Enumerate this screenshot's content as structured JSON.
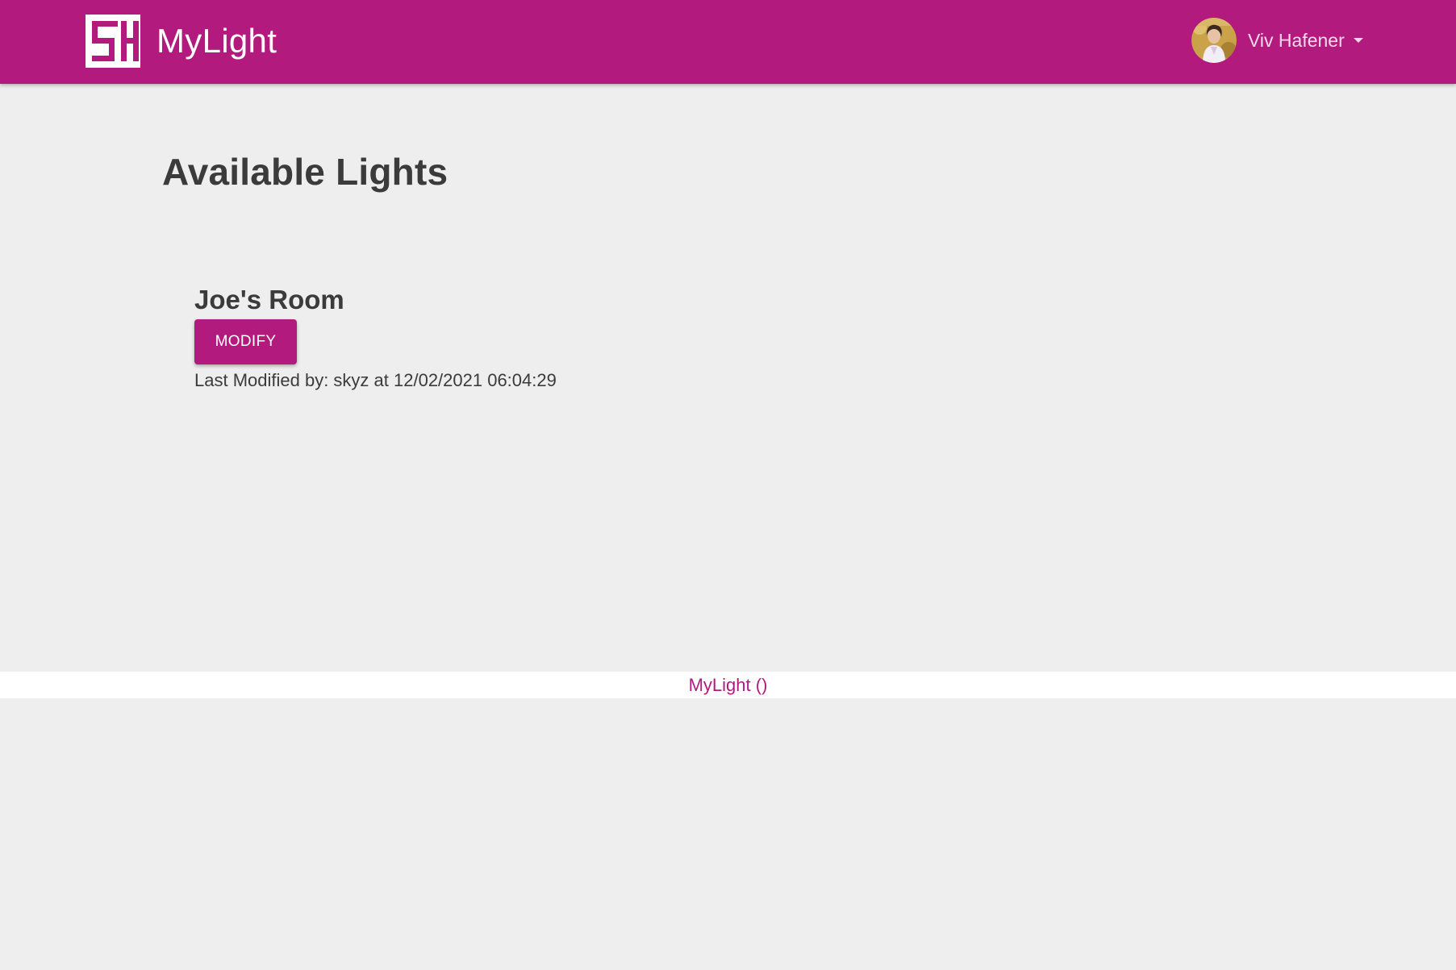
{
  "header": {
    "brand_name": "MyLight",
    "logo_icon": "mylight-logo-icon",
    "user": {
      "name": "Viv Hafener",
      "avatar_icon": "user-avatar"
    },
    "accent_color": "#b21a7e"
  },
  "main": {
    "title": "Available Lights",
    "lights": [
      {
        "name": "Joe's Room",
        "modify_label": "MODIFY",
        "last_modified": "Last Modified by: skyz at 12/02/2021 06:04:29"
      }
    ]
  },
  "footer": {
    "link_text": "MyLight ()"
  }
}
